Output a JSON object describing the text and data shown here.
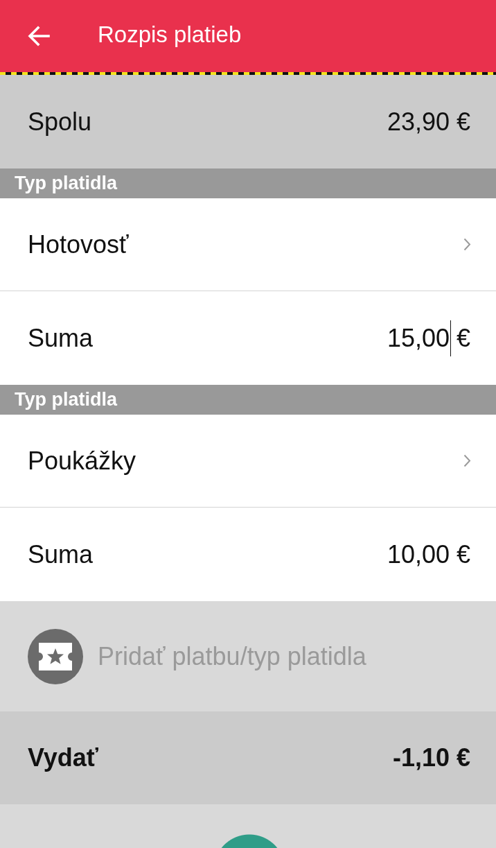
{
  "app_bar": {
    "title": "Rozpis platieb"
  },
  "total": {
    "label": "Spolu",
    "value": "23,90 €"
  },
  "payments": [
    {
      "section_title": "Typ platidla",
      "type": "Hotovosť",
      "amount_label": "Suma",
      "amount": "15,00",
      "currency": "€",
      "focused": true
    },
    {
      "section_title": "Typ platidla",
      "type": "Poukážky",
      "amount_label": "Suma",
      "amount": "10,00",
      "currency": "€",
      "focused": false
    }
  ],
  "add_payment": {
    "label": "Pridať platbu/typ platidla"
  },
  "change": {
    "label": "Vydať",
    "value": "-1,10 €"
  }
}
